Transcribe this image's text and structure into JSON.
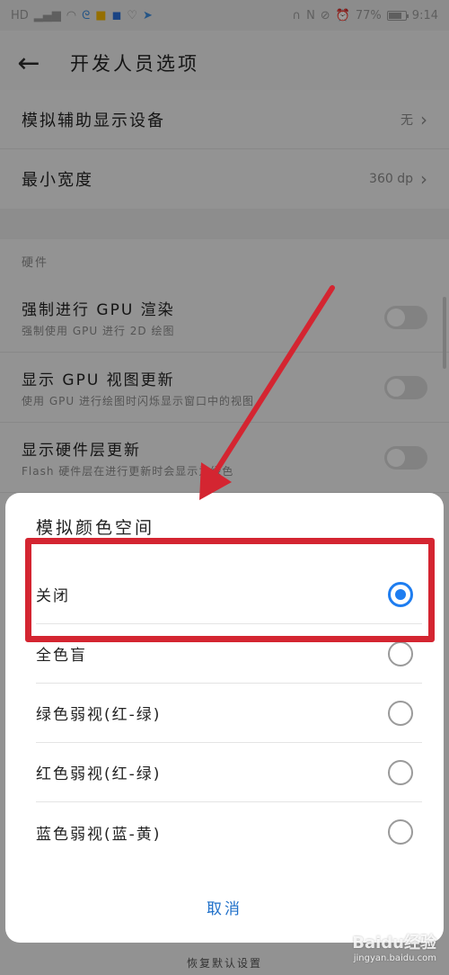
{
  "status_bar": {
    "left_icons": [
      "hd-icon",
      "signal-icon",
      "wifi-icon",
      "qq-icon",
      "chat-icon",
      "shield-icon",
      "heart-icon",
      "feather-icon"
    ],
    "right_icons": [
      "headphones-icon",
      "nfc-icon",
      "mute-icon",
      "alarm-icon",
      "signal-icon"
    ],
    "battery": "77%",
    "battery_level": 0.77,
    "time": "9:14"
  },
  "header": {
    "title": "开发人员选项"
  },
  "settings": {
    "simulate_display": {
      "label": "模拟辅助显示设备",
      "value": "无"
    },
    "min_width": {
      "label": "最小宽度",
      "value": "360 dp"
    },
    "section_label": "硬件",
    "toggles": [
      {
        "title": "强制进行 GPU 渲染",
        "subtitle": "强制使用 GPU 进行 2D 绘图",
        "on": false
      },
      {
        "title": "显示 GPU 视图更新",
        "subtitle": "使用 GPU 进行绘图时闪烁显示窗口中的视图",
        "on": false
      },
      {
        "title": "显示硬件层更新",
        "subtitle": "Flash 硬件层在进行更新时会显示为绿色",
        "on": false
      }
    ]
  },
  "dialog": {
    "title": "模拟颜色空间",
    "options": [
      {
        "label": "关闭",
        "selected": true
      },
      {
        "label": "全色盲",
        "selected": false
      },
      {
        "label": "绿色弱视(红-绿)",
        "selected": false
      },
      {
        "label": "红色弱视(红-绿)",
        "selected": false
      },
      {
        "label": "蓝色弱视(蓝-黄)",
        "selected": false
      }
    ],
    "cancel_label": "取消"
  },
  "footer": {
    "restore_label": "恢复默认设置"
  },
  "watermark": {
    "brand": "Baidu经验",
    "url": "jingyan.baidu.com"
  },
  "colors": {
    "accent": "#1e7df0",
    "annotation_red": "#d42531",
    "cancel_text": "#1e6fc9"
  }
}
